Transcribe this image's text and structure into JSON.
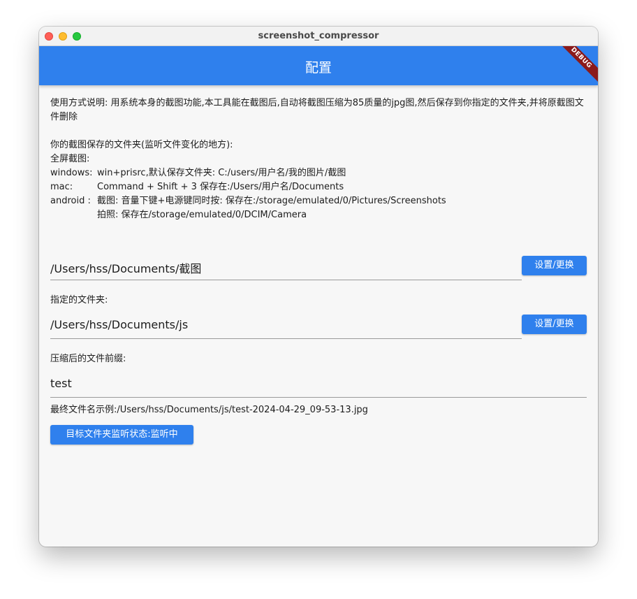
{
  "window": {
    "title": "screenshot_compressor"
  },
  "appbar": {
    "title": "配置",
    "debug_banner": "DEBUG"
  },
  "description": "使用方式说明: 用系统本身的截图功能,本工具能在截图后,自动将截图压缩为85质量的jpg图,然后保存到你指定的文件夹,并将原截图文件删除",
  "screenshot_info": {
    "heading": "你的截图保存的文件夹(监听文件变化的地方):",
    "fullscreen": "全屏截图:",
    "windows_key": "windows:",
    "windows_value": "win+prisrc,默认保存文件夹: C:/users/用户名/我的图片/截图",
    "mac_key": "mac:",
    "mac_value": "Command + Shift + 3 保存在:/Users/用户名/Documents",
    "android_key": "android :",
    "android_value1": "截图: 音量下键+电源键同时按: 保存在:/storage/emulated/0/Pictures/Screenshots",
    "android_value2": "拍照: 保存在/storage/emulated/0/DCIM/Camera"
  },
  "screenshot_folder": {
    "value": "/Users/hss/Documents/截图",
    "button": "设置/更换"
  },
  "target_folder": {
    "label": "指定的文件夹:",
    "value": "/Users/hss/Documents/js",
    "button": "设置/更换"
  },
  "prefix": {
    "label": "压缩后的文件前缀:",
    "value": "test"
  },
  "example": "最终文件名示例:/Users/hss/Documents/js/test-2024-04-29_09-53-13.jpg",
  "monitor_button": "目标文件夹监听状态:监听中",
  "colors": {
    "accent": "#2f80ed",
    "background": "#f7f7f7",
    "debug_banner": "#8b1a1a"
  }
}
